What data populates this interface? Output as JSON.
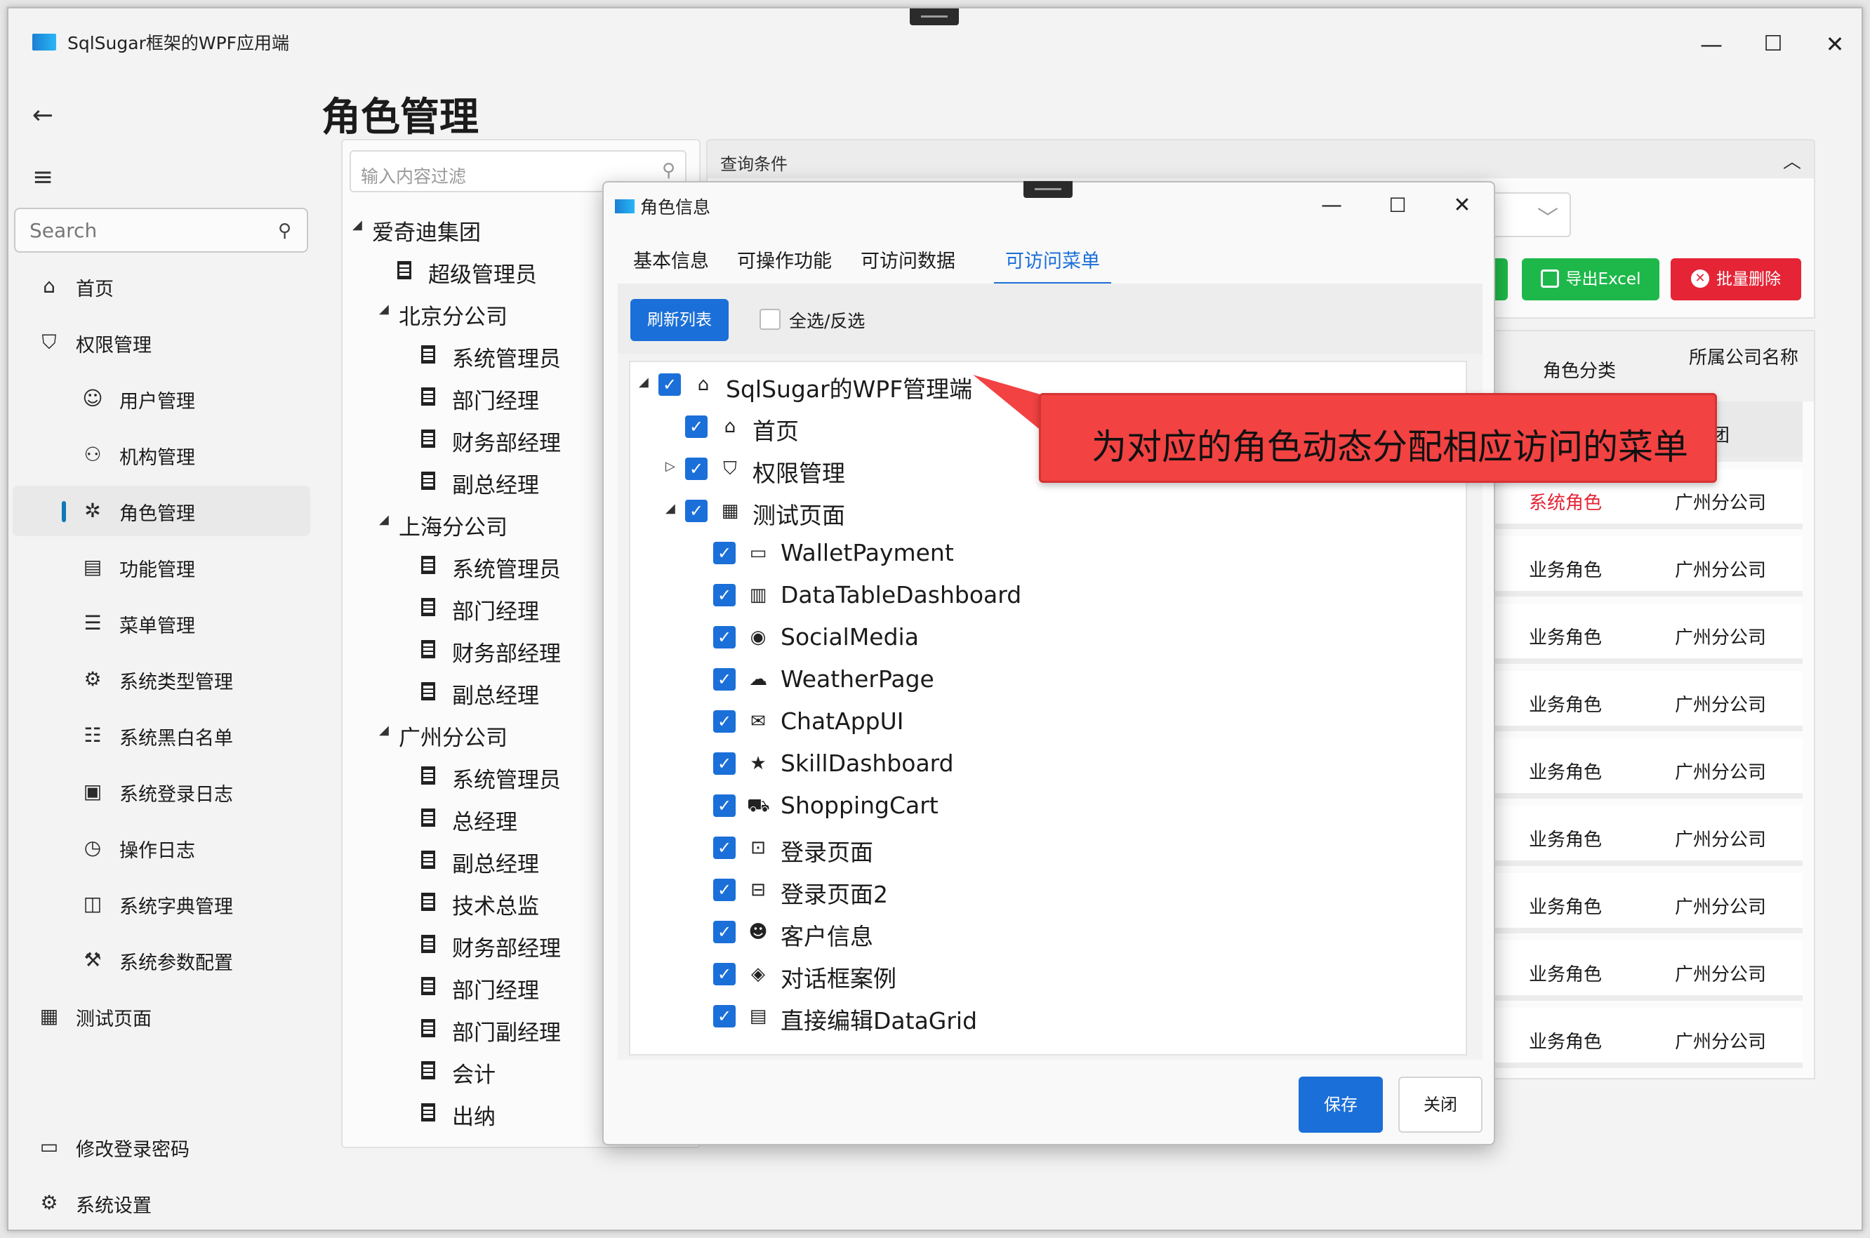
{
  "app": {
    "title": "SqlSugar框架的WPF应用端"
  },
  "sidebar": {
    "search_placeholder": "Search",
    "items": [
      {
        "label": "首页",
        "icon": "home-icon",
        "level": 0
      },
      {
        "label": "权限管理",
        "icon": "shield-icon",
        "level": 0
      },
      {
        "label": "用户管理",
        "icon": "user-icon",
        "level": 1
      },
      {
        "label": "机构管理",
        "icon": "org-icon",
        "level": 1
      },
      {
        "label": "角色管理",
        "icon": "role-icon",
        "level": 1,
        "active": true
      },
      {
        "label": "功能管理",
        "icon": "function-icon",
        "level": 1
      },
      {
        "label": "菜单管理",
        "icon": "menu-icon",
        "level": 1
      },
      {
        "label": "系统类型管理",
        "icon": "system-type-icon",
        "level": 1
      },
      {
        "label": "系统黑白名单",
        "icon": "blacklist-icon",
        "level": 1
      },
      {
        "label": "系统登录日志",
        "icon": "login-log-icon",
        "level": 1
      },
      {
        "label": "操作日志",
        "icon": "operation-log-icon",
        "level": 1
      },
      {
        "label": "系统字典管理",
        "icon": "dictionary-icon",
        "level": 1
      },
      {
        "label": "系统参数配置",
        "icon": "config-icon",
        "level": 1
      },
      {
        "label": "测试页面",
        "icon": "test-page-icon",
        "level": 0
      }
    ],
    "footer": [
      {
        "label": "修改登录密码",
        "icon": "password-icon"
      },
      {
        "label": "系统设置",
        "icon": "settings-icon"
      }
    ]
  },
  "page": {
    "title": "角色管理"
  },
  "org_tree": {
    "filter_placeholder": "输入内容过滤",
    "nodes": [
      {
        "label": "爱奇迪集团",
        "level": 0,
        "expandable": true
      },
      {
        "label": "超级管理员",
        "level": 1,
        "leaf": true
      },
      {
        "label": "北京分公司",
        "level": 1,
        "expandable": true
      },
      {
        "label": "系统管理员",
        "level": 2,
        "leaf": true
      },
      {
        "label": "部门经理",
        "level": 2,
        "leaf": true
      },
      {
        "label": "财务部经理",
        "level": 2,
        "leaf": true
      },
      {
        "label": "副总经理",
        "level": 2,
        "leaf": true
      },
      {
        "label": "上海分公司",
        "level": 1,
        "expandable": true
      },
      {
        "label": "系统管理员",
        "level": 2,
        "leaf": true
      },
      {
        "label": "部门经理",
        "level": 2,
        "leaf": true
      },
      {
        "label": "财务部经理",
        "level": 2,
        "leaf": true
      },
      {
        "label": "副总经理",
        "level": 2,
        "leaf": true
      },
      {
        "label": "广州分公司",
        "level": 1,
        "expandable": true
      },
      {
        "label": "系统管理员",
        "level": 2,
        "leaf": true
      },
      {
        "label": "总经理",
        "level": 2,
        "leaf": true
      },
      {
        "label": "副总经理",
        "level": 2,
        "leaf": true
      },
      {
        "label": "技术总监",
        "level": 2,
        "leaf": true
      },
      {
        "label": "财务部经理",
        "level": 2,
        "leaf": true
      },
      {
        "label": "部门经理",
        "level": 2,
        "leaf": true
      },
      {
        "label": "部门副经理",
        "level": 2,
        "leaf": true
      },
      {
        "label": "会计",
        "level": 2,
        "leaf": true
      },
      {
        "label": "出纳",
        "level": 2,
        "leaf": true
      }
    ]
  },
  "query": {
    "title": "查询条件",
    "export_label": "导出Excel",
    "delete_label": "批量删除"
  },
  "grid": {
    "headers": {
      "category": "角色分类",
      "company": "所属公司名称"
    },
    "rows": [
      {
        "category": "",
        "company": "迪集团"
      },
      {
        "category": "系统角色",
        "company": "广州分公司",
        "highlight": true
      },
      {
        "category": "业务角色",
        "company": "广州分公司"
      },
      {
        "category": "业务角色",
        "company": "广州分公司"
      },
      {
        "category": "业务角色",
        "company": "广州分公司"
      },
      {
        "category": "业务角色",
        "company": "广州分公司"
      },
      {
        "category": "业务角色",
        "company": "广州分公司"
      },
      {
        "category": "业务角色",
        "company": "广州分公司"
      },
      {
        "category": "业务角色",
        "company": "广州分公司"
      },
      {
        "category": "业务角色",
        "company": "广州分公司"
      }
    ]
  },
  "dialog": {
    "title": "角色信息",
    "tabs": [
      "基本信息",
      "可操作功能",
      "可访问数据",
      "可访问菜单"
    ],
    "active_tab": 3,
    "refresh_label": "刷新列表",
    "select_all_label": "全选/反选",
    "save_label": "保存",
    "close_label": "关闭",
    "menu_items": [
      {
        "label": "SqlSugar的WPF管理端",
        "level": 0,
        "expander": "expanded",
        "icon": "home-icon",
        "checked": true
      },
      {
        "label": "首页",
        "level": 1,
        "expander": "none",
        "icon": "home-icon",
        "checked": true
      },
      {
        "label": "权限管理",
        "level": 1,
        "expander": "collapsed",
        "icon": "shield-icon",
        "checked": true
      },
      {
        "label": "测试页面",
        "level": 1,
        "expander": "expanded",
        "icon": "grid-icon",
        "checked": true
      },
      {
        "label": "WalletPayment",
        "level": 2,
        "expander": "none",
        "icon": "wallet-icon",
        "checked": true
      },
      {
        "label": "DataTableDashboard",
        "level": 2,
        "expander": "none",
        "icon": "table-icon",
        "checked": true
      },
      {
        "label": "SocialMedia",
        "level": 2,
        "expander": "none",
        "icon": "social-icon",
        "checked": true
      },
      {
        "label": "WeatherPage",
        "level": 2,
        "expander": "none",
        "icon": "weather-icon",
        "checked": true
      },
      {
        "label": "ChatAppUI",
        "level": 2,
        "expander": "none",
        "icon": "chat-icon",
        "checked": true
      },
      {
        "label": "SkillDashboard",
        "level": 2,
        "expander": "none",
        "icon": "skill-icon",
        "checked": true
      },
      {
        "label": "ShoppingCart",
        "level": 2,
        "expander": "none",
        "icon": "cart-icon",
        "checked": true
      },
      {
        "label": "登录页面",
        "level": 2,
        "expander": "none",
        "icon": "login-icon",
        "checked": true
      },
      {
        "label": "登录页面2",
        "level": 2,
        "expander": "none",
        "icon": "login2-icon",
        "checked": true
      },
      {
        "label": "客户信息",
        "level": 2,
        "expander": "none",
        "icon": "customer-icon",
        "checked": true
      },
      {
        "label": "对话框案例",
        "level": 2,
        "expander": "none",
        "icon": "dialog-icon",
        "checked": true
      },
      {
        "label": "直接编辑DataGrid",
        "level": 2,
        "expander": "none",
        "icon": "datagrid-icon",
        "checked": true
      }
    ]
  },
  "annotation": {
    "text": "为对应的角色动态分配相应访问的菜单"
  },
  "colors": {
    "accent": "#1b6fd8",
    "success": "#1eb84a",
    "danger": "#e52436",
    "callout": "#f24242"
  }
}
